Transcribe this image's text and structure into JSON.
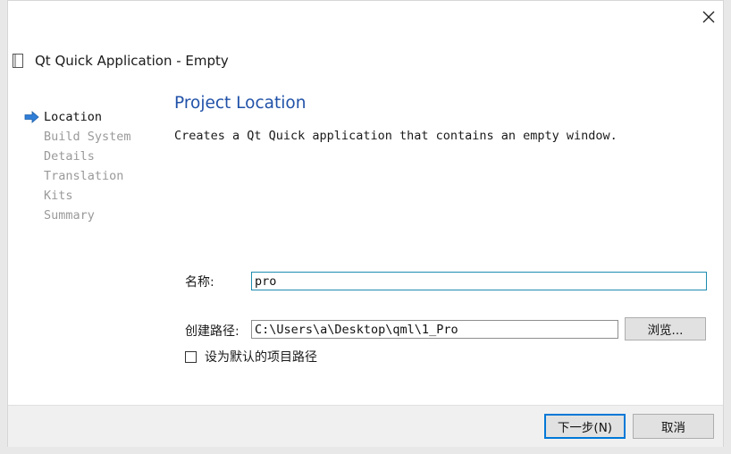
{
  "window": {
    "title": "Qt Quick Application - Empty"
  },
  "steps": [
    {
      "label": "Location",
      "active": true
    },
    {
      "label": "Build System",
      "active": false
    },
    {
      "label": "Details",
      "active": false
    },
    {
      "label": "Translation",
      "active": false
    },
    {
      "label": "Kits",
      "active": false
    },
    {
      "label": "Summary",
      "active": false
    }
  ],
  "page": {
    "heading": "Project Location",
    "description": "Creates a Qt Quick application that contains an empty window."
  },
  "form": {
    "name_label": "名称:",
    "name_value": "pro",
    "path_label": "创建路径:",
    "path_value": "C:\\Users\\a\\Desktop\\qml\\1_Pro",
    "browse_label": "浏览...",
    "default_checkbox_label": "设为默认的项目路径",
    "default_checked": false
  },
  "footer": {
    "next_label": "下一步(N)",
    "cancel_label": "取消"
  },
  "colors": {
    "heading": "#2051a8",
    "active_step_arrow": "#2f7ed8",
    "focus_border": "#1f8cb0",
    "default_button_border": "#0078d7"
  },
  "icons": {
    "close": "close-icon",
    "title": "project-document-icon",
    "active_step": "arrow-right-icon"
  }
}
